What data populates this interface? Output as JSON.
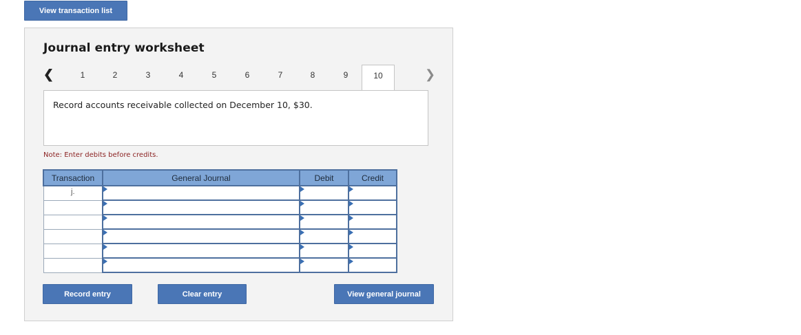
{
  "top_button": "View transaction list",
  "worksheet": {
    "title": "Journal entry worksheet",
    "tabs": [
      "1",
      "2",
      "3",
      "4",
      "5",
      "6",
      "7",
      "8",
      "9"
    ],
    "active_tab": "10",
    "prev_icon": "chevron-left-icon",
    "next_icon": "chevron-right-icon",
    "description": "Record accounts receivable collected on December 10, $30.",
    "note": "Note: Enter debits before credits."
  },
  "table": {
    "headers": {
      "transaction": "Transaction",
      "general_journal": "General Journal",
      "debit": "Debit",
      "credit": "Credit"
    },
    "transaction_label": "j."
  },
  "buttons": {
    "record": "Record entry",
    "clear": "Clear entry",
    "view_journal": "View general journal"
  },
  "colors": {
    "button_blue": "#4a76b6",
    "header_blue": "#7fa6d7",
    "note_red": "#8b2222"
  }
}
